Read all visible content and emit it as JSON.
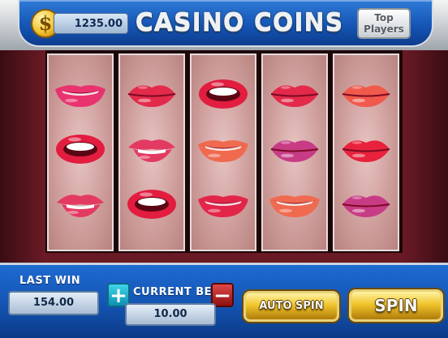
{
  "header": {
    "coin_symbol": "$",
    "balance": "1235.00",
    "title": "CASINO COINS",
    "top_players_line1": "Top",
    "top_players_line2": "Players"
  },
  "reels": [
    [
      "lips-smile-pink",
      "lips-open-red",
      "lips-bite"
    ],
    [
      "lips-pout-red",
      "lips-bite",
      "lips-open-red"
    ],
    [
      "lips-open-red",
      "lips-smile-coral",
      "lips-smile-red"
    ],
    [
      "lips-pout-red",
      "lips-pout-magenta",
      "lips-smile-coral"
    ],
    [
      "lips-pout-coral",
      "lips-closed-red",
      "lips-pout-magenta"
    ]
  ],
  "symbol_colors": {
    "lips-smile-pink": "#e8336e",
    "lips-open-red": "#e21d3f",
    "lips-bite": "#e33a62",
    "lips-pout-red": "#e32a4a",
    "lips-smile-coral": "#ef6a4f",
    "lips-smile-red": "#e3254a",
    "lips-pout-magenta": "#c83c86",
    "lips-pout-coral": "#f05a4c",
    "lips-closed-red": "#e8223c"
  },
  "controls": {
    "last_win_label": "LAST WIN",
    "last_win_value": "154.00",
    "current_bet_label": "CURRENT BET",
    "current_bet_value": "10.00",
    "plus_label": "+",
    "minus_label": "−",
    "auto_spin_label": "AUTO SPIN",
    "spin_label": "SPIN"
  }
}
